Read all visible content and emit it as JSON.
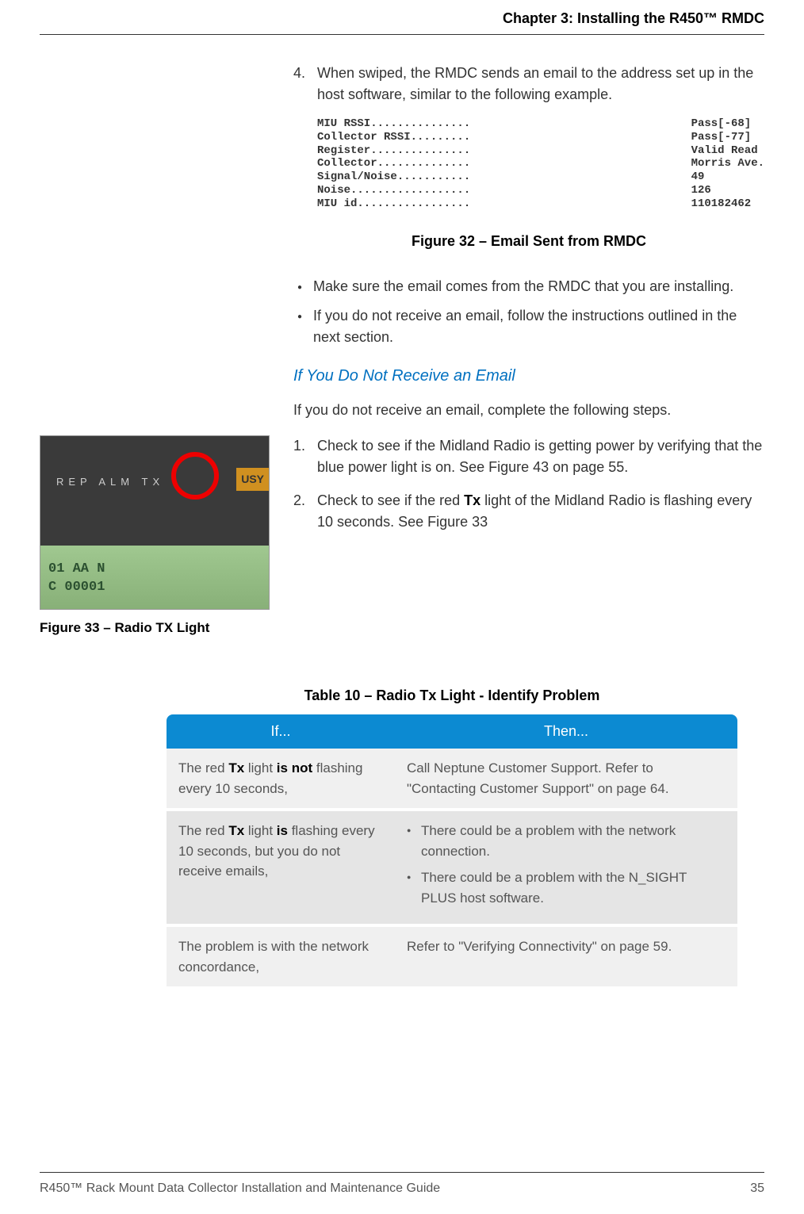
{
  "header": {
    "chapter": "Chapter 3: Installing the R450™ RMDC"
  },
  "step4": {
    "num": "4.",
    "text": "When swiped, the RMDC sends an email to the address set up in the host software, similar to the following example."
  },
  "mono": {
    "left": "MIU RSSI...............\nCollector RSSI.........\nRegister...............\nCollector..............\nSignal/Noise...........\nNoise..................\nMIU id.................",
    "right": "Pass[-68]\nPass[-77]\nValid Read\nMorris Ave.\n49\n126\n110182462"
  },
  "fig32": "Figure 32  –  Email Sent from RMDC",
  "bullets": [
    "Make sure the email comes from the RMDC that you are installing.",
    "If you do not receive an email, follow the instructions outlined in the next section."
  ],
  "subhead": "If You Do Not Receive an Email",
  "intro": "If you do not receive an email, complete the following steps.",
  "steps": [
    {
      "num": "1.",
      "text": "Check to see if the Midland Radio is getting power by verifying that the blue power light is on. See Figure 43 on page 55."
    },
    {
      "num": "2.",
      "pre": "Check to see if the red ",
      "bold": "Tx",
      "post": " light of the Midland Radio is flashing every 10 seconds. See Figure 33"
    }
  ],
  "radio": {
    "labels": "REP    ALM     TX",
    "busy": "USY",
    "lcd1": "01           AA N",
    "lcd2": "C 00001"
  },
  "fig33": "Figure 33  –  Radio TX Light",
  "table": {
    "caption": "Table 10  –  Radio Tx Light - Identify Problem",
    "head": [
      "If...",
      "Then..."
    ],
    "rows": [
      {
        "if_pre": "The red ",
        "if_b1": "Tx",
        "if_mid": " light ",
        "if_b2": "is not",
        "if_post": " flashing every 10 seconds,",
        "then": "Call Neptune Customer Support. Refer to \"Contacting Customer Support\" on page 64."
      },
      {
        "if_pre": "The red ",
        "if_b1": "Tx",
        "if_mid": " light ",
        "if_b2": "is",
        "if_post": " flashing every 10 seconds, but you do not receive emails,",
        "then_bullets": [
          "There could be a problem with the network connection.",
          "There could be a problem with the N_SIGHT PLUS host software."
        ]
      },
      {
        "if_plain": "The problem is with the network concordance,",
        "then": "Refer to \"Verifying Connectivity\" on page 59."
      }
    ]
  },
  "footer": {
    "left": "R450™ Rack Mount Data Collector Installation and Maintenance Guide",
    "right": "35"
  }
}
